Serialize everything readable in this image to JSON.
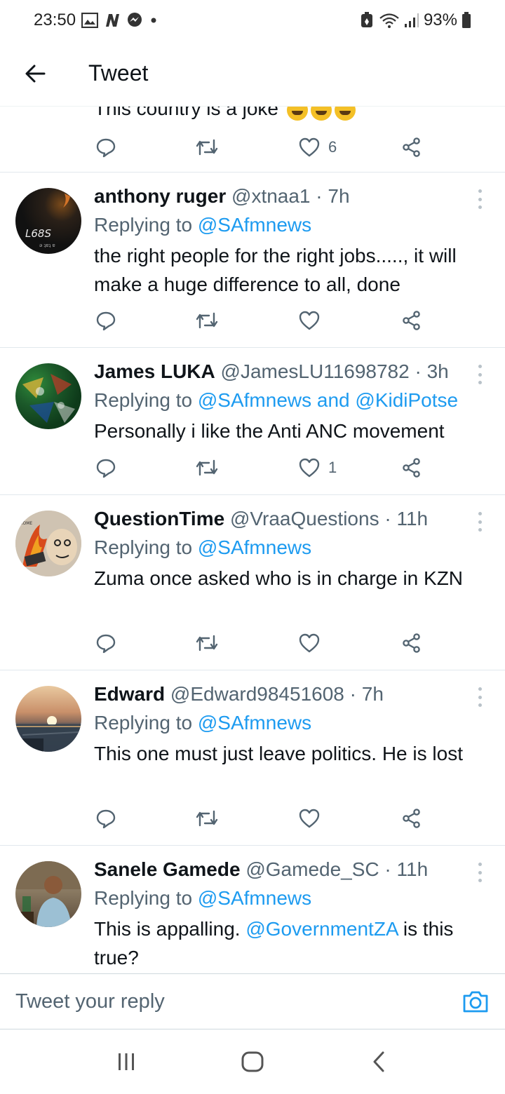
{
  "status_bar": {
    "time": "23:50",
    "battery": "93%"
  },
  "header": {
    "title": "Tweet"
  },
  "previous_tweet": {
    "text": "This country is a joke",
    "like_count": "6"
  },
  "tweets": [
    {
      "name": "anthony ruger",
      "handle": "@xtnaa1",
      "sep": " · ",
      "time": "7h",
      "replying_prefix": "Replying to ",
      "replying_to": "@SAfmnews",
      "text": "the right people for the right jobs....., it will make a huge difference to all, done",
      "like_count": "",
      "avatar_text": "L68S"
    },
    {
      "name": "James LUKA",
      "handle": "@JamesLU11698782",
      "sep": " · ",
      "time": "3h",
      "replying_prefix": "Replying to ",
      "replying_to": "@SAfmnews and @KidiPotse",
      "text": "Personally i like the Anti ANC movement",
      "like_count": "1"
    },
    {
      "name": "QuestionTime",
      "handle": "@VraaQuestions",
      "sep": " · ",
      "time": "11h",
      "replying_prefix": "Replying to ",
      "replying_to": "@SAfmnews",
      "text": "Zuma once asked who is in charge in KZN",
      "like_count": ""
    },
    {
      "name": "Edward",
      "handle": "@Edward98451608",
      "sep": " · ",
      "time": "7h",
      "replying_prefix": "Replying to ",
      "replying_to": "@SAfmnews",
      "text": "This one must just leave politics. He is lost",
      "like_count": ""
    },
    {
      "name": "Sanele Gamede",
      "handle": "@Gamede_SC",
      "sep": " · ",
      "time": "11h",
      "replying_prefix": "Replying to ",
      "replying_to": "@SAfmnews",
      "text_before": "This is appalling. ",
      "text_mention": "@GovernmentZA",
      "text_after": " is this true?",
      "like_count": ""
    }
  ],
  "reply_bar": {
    "placeholder": "Tweet your reply"
  },
  "icons": {
    "back": "arrow-left-icon",
    "reply": "comment-bubble-icon",
    "retweet": "retweet-icon",
    "like": "heart-icon",
    "share": "share-nodes-icon",
    "more": "more-vertical-icon",
    "camera": "camera-icon"
  },
  "colors": {
    "accent": "#1d9bf0",
    "text": "#0f1419",
    "secondary": "#536471",
    "divider": "#e1e8ed"
  }
}
